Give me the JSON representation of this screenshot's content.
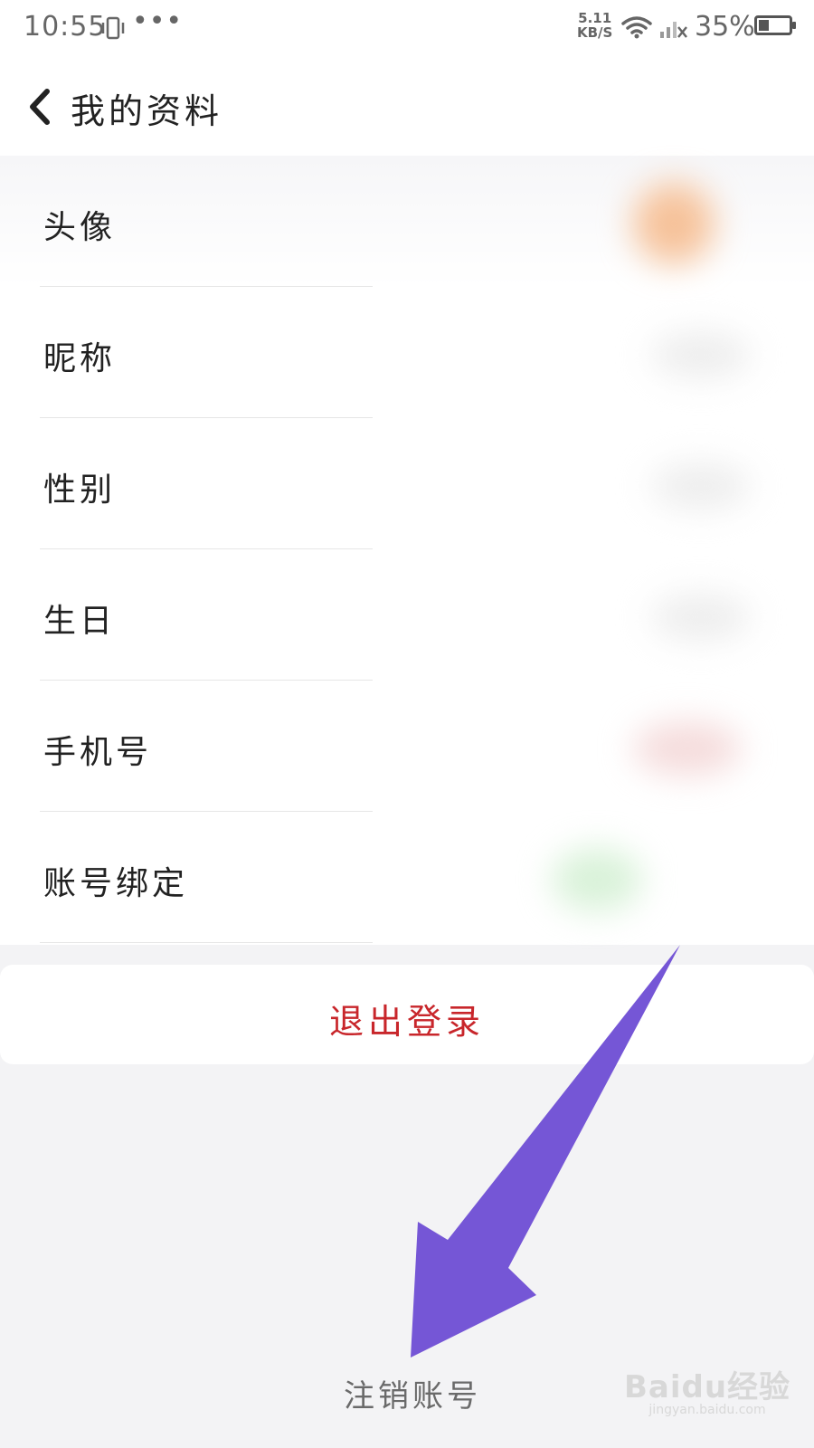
{
  "status_bar": {
    "time": "10:55",
    "dots": "•••",
    "net_speed_value": "5.11",
    "net_speed_unit": "KB/S",
    "battery_percent": "35%",
    "battery_level": 0.35
  },
  "header": {
    "title": "我的资料"
  },
  "profile_items": [
    {
      "label": "头像"
    },
    {
      "label": "昵称"
    },
    {
      "label": "性别"
    },
    {
      "label": "生日"
    },
    {
      "label": "手机号"
    },
    {
      "label": "账号绑定"
    }
  ],
  "logout": {
    "label": "退出登录"
  },
  "cancel_account": {
    "label": "注销账号"
  },
  "colors": {
    "logout_text": "#c8262b",
    "annotation_arrow": "#7556d6",
    "background": "#f3f3f5"
  },
  "watermark": {
    "brand": "Baidu经验",
    "url": "jingyan.baidu.com"
  }
}
